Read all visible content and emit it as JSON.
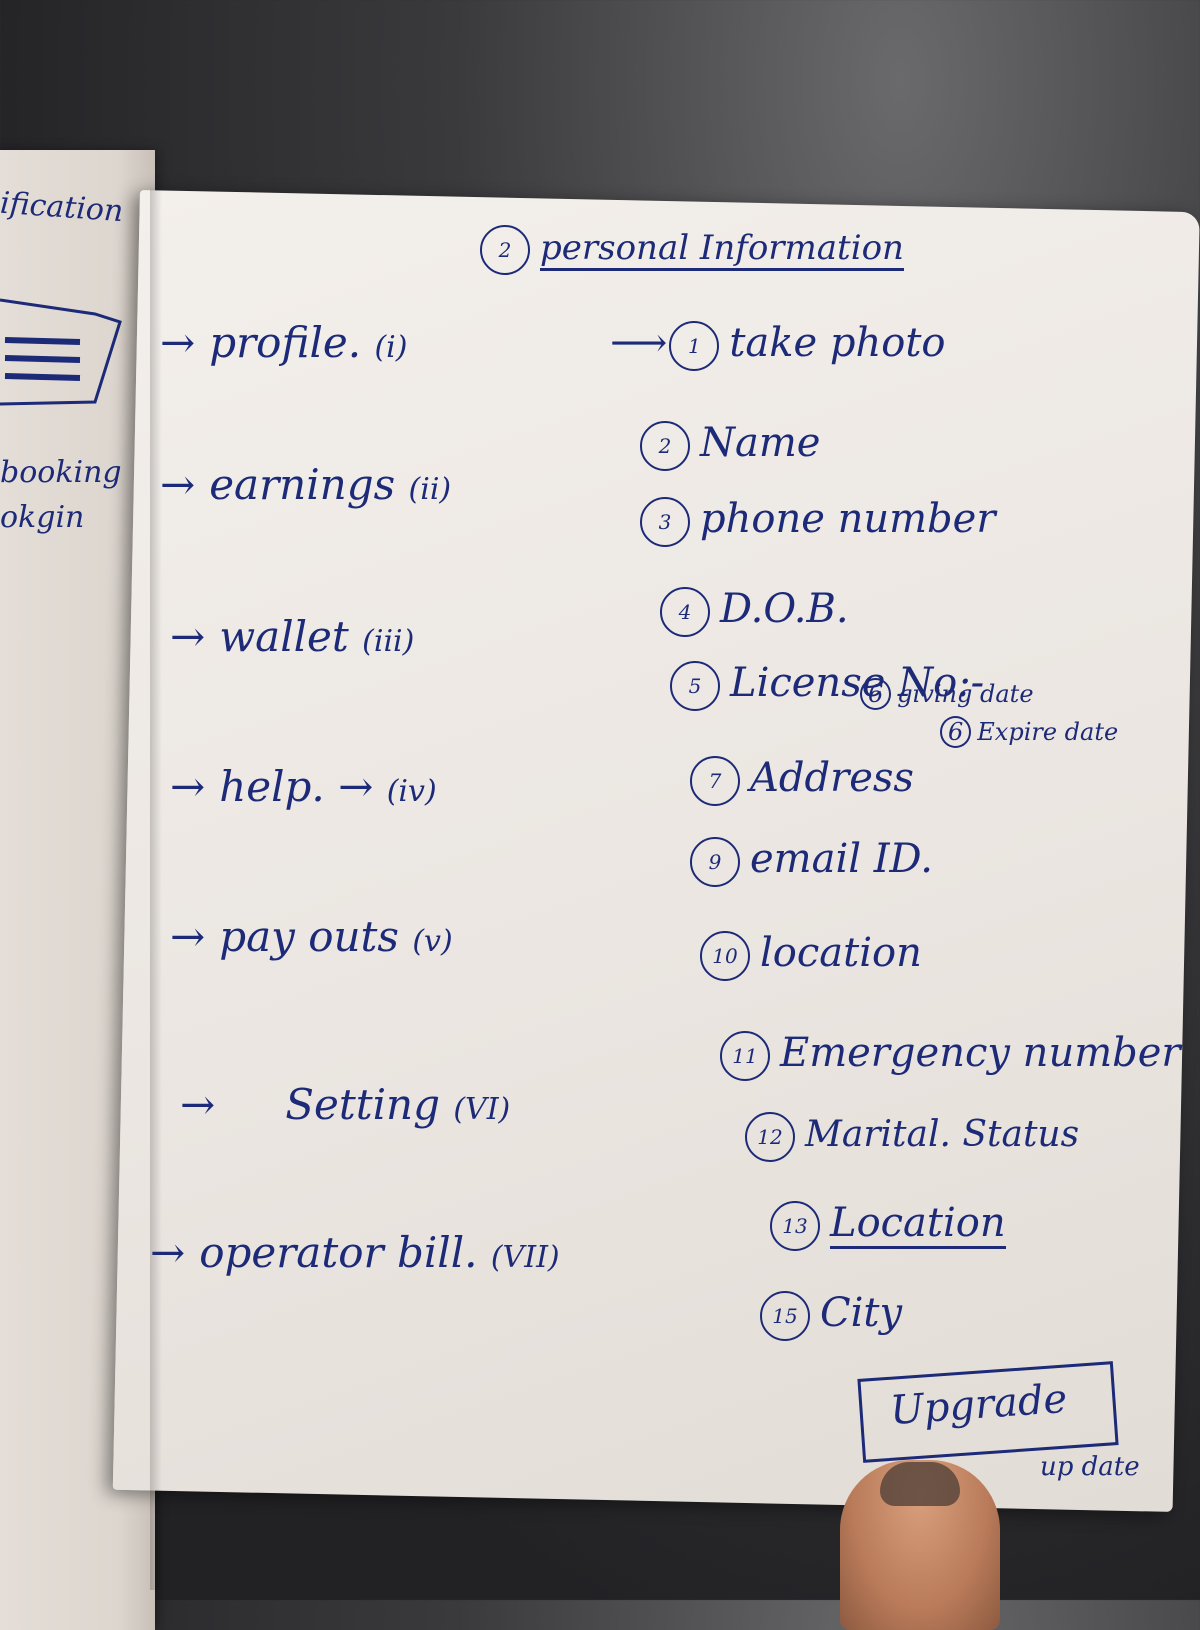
{
  "left_page": {
    "line1": "ification",
    "line2": "booking",
    "line3": "okgin"
  },
  "heading": {
    "number": "2",
    "text": "personal Information"
  },
  "menu": [
    {
      "label": "profile.",
      "num": "(i)"
    },
    {
      "label": "earnings",
      "num": "(ii)"
    },
    {
      "label": "wallet",
      "num": "(iii)"
    },
    {
      "label": "help.",
      "num": "(iv)"
    },
    {
      "label": "pay outs",
      "num": "(v)"
    },
    {
      "label": "Setting",
      "num": "(VI)"
    },
    {
      "label": "operator bill.",
      "num": "(VII)"
    }
  ],
  "fields": [
    {
      "num": "1",
      "label": "take photo"
    },
    {
      "num": "2",
      "label": "Name"
    },
    {
      "num": "3",
      "label": "phone number"
    },
    {
      "num": "4",
      "label": "D.O.B."
    },
    {
      "num": "5",
      "label": "License No:-"
    },
    {
      "num": "7",
      "label": "Address"
    },
    {
      "num": "9",
      "label": "email ID."
    },
    {
      "num": "10",
      "label": "location"
    },
    {
      "num": "11",
      "label": "Emergency number"
    },
    {
      "num": "12",
      "label": "Marital. Status"
    },
    {
      "num": "13",
      "label": "Location"
    },
    {
      "num": "15",
      "label": "City"
    }
  ],
  "license_sub": [
    {
      "num": "6",
      "label": "giving date"
    },
    {
      "num": "6",
      "label": "Expire date"
    }
  ],
  "upgrade": {
    "label": "Upgrade",
    "note": "up date"
  }
}
